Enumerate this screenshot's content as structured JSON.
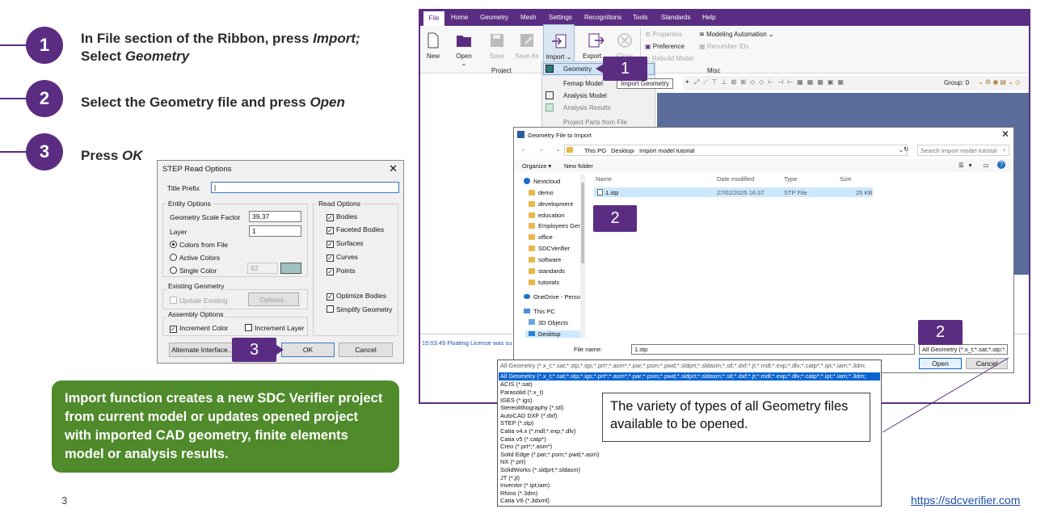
{
  "steps": [
    {
      "num": "1",
      "line1": "In File section of the Ribbon, press ",
      "em1": "Import;",
      "line2": "Select ",
      "em2": "Geometry"
    },
    {
      "num": "2",
      "text": "Select the Geometry file and press ",
      "em": "Open"
    },
    {
      "num": "3",
      "text": "Press ",
      "em": "OK"
    }
  ],
  "note": "Import function creates a new SDC Verifier project from current model or updates opened project with imported CAD geometry, finite elements model or analysis results.",
  "page_number": "3",
  "website": "https://sdcverifier.com",
  "step_dialog": {
    "title": "STEP Read Options",
    "title_prefix_label": "Title Prefix",
    "entity_options": "Entity Options",
    "scale_label": "Geometry Scale Factor",
    "scale_value": "39,37",
    "layer_label": "Layer",
    "layer_value": "1",
    "colors_from_file": "Colors from File",
    "active_colors": "Active Colors",
    "single_color": "Single Color",
    "single_color_value": "92",
    "existing_geometry": "Existing Geometry",
    "update_existing": "Update Existing",
    "options_btn": "Options..",
    "assembly_options": "Assembly Options",
    "increment_color": "Increment Color",
    "increment_layer": "Increment Layer",
    "read_options": "Read Options",
    "read_items": [
      "Bodies",
      "Faceted Bodies",
      "Surfaces",
      "Curves",
      "Points"
    ],
    "optimize_bodies": "Optimize Bodies",
    "simplify_geometry": "Simplify Geometry",
    "alt_btn": "Alternate Interface...",
    "ok_btn": "OK",
    "cancel_btn": "Cancel"
  },
  "app": {
    "menu": [
      "File",
      "Home",
      "Geometry",
      "Mesh",
      "Settings",
      "Recognitions",
      "Tools",
      "Standards",
      "Help"
    ],
    "ribbon": {
      "new": "New",
      "open": "Open",
      "save": "Save",
      "save_as": "Save As",
      "import": "Import",
      "export": "Export",
      "close": "Close",
      "properties": "Properties",
      "preference": "Preference",
      "rebuild_model": "Rebuild Model",
      "modeling_automation": "Modeling Automation",
      "renumber_ids": "Renumber IDs",
      "project_group": "Project",
      "misc_group": "Misc"
    },
    "group_label": "Group: 0",
    "log_text": "15:03:49 Floating License was su"
  },
  "import_menu": {
    "items": [
      "Geometry",
      "Femap Model",
      "Analysis Model",
      "Analysis Results",
      "Project Parts from File"
    ],
    "tooltip": "Import Geometry"
  },
  "file_dialog": {
    "title": "Geometry File to Import",
    "path": [
      "This PC",
      "Desktop",
      "Import model tutorial"
    ],
    "search_placeholder": "Search Import model tutorial",
    "organize": "Organize",
    "new_folder": "New folder",
    "nav": [
      "Nextcloud",
      "demo",
      "development",
      "education",
      "Employees Gene",
      "office",
      "SDCVerifier",
      "software",
      "standards",
      "tutorials",
      "OneDrive - Persor",
      "This PC",
      "3D Objects",
      "Desktop"
    ],
    "columns": [
      "Name",
      "Date modified",
      "Type",
      "Size"
    ],
    "file": {
      "name": "1.stp",
      "date": "27/02/2025 16:37",
      "type": "STP File",
      "size": "25 KB"
    },
    "file_name_label": "File name:",
    "file_name_value": "1.stp",
    "file_type_value": "All Geometry (*.x_t;*.sat;*.stp;*.",
    "open_btn": "Open",
    "cancel_btn": "Cancel"
  },
  "type_list": {
    "header": "All Geometry (*.x_t;*.sat;*.stp;*.igs;*.prt*;*.asm*;*.par;*.psm;*.pwd;*.sldprt;*.sldasm;*.stl;*.dxf;*.jt;*.mdl;*.exp;*.dlv;*.catp*;*.ipt;*.iam;*.3dm;",
    "items": [
      "All Geometry (*.x_t;*.sat;*.stp;*.igs;*.prt*;*.asm*;*.par;*.psm;*.pwd;*.sldprt;*.sldasm;*.stl;*.dxf;*.jt;*.mdl;*.exp;*.dlv;*.catp*;*.ipt;*.iam;*.3dm;",
      "ACIS (*.sat)",
      "Parasolid (*.x_t)",
      "IGES (*.igs)",
      "Stereolithography (*.stl)",
      "AutoCAD DXF (*.dxf)",
      "STEP (*.stp)",
      "Catia v4.x (*.mdl;*.exp;*.dlv)",
      "Catia v5 (*.catp*)",
      "Creo (*.prt*;*.asm*)",
      "Solid Edge (*.par;*.psm;*.pwd;*.asm)",
      "NX (*.prt)",
      "SolidWorks (*.sldprt;*.sldasm)",
      "JT (*.jt)",
      "Inventor (*.ipt;iam)",
      "Rhino (*.3dm)",
      "Catia V6 (*.3dxml)"
    ],
    "note": "The variety of types of all Geometry files available to be opened."
  },
  "callouts": [
    "1",
    "2",
    "2",
    "3"
  ],
  "colors": {
    "purple": "#5b2d82",
    "green": "#4f8a2b",
    "link": "#1f4fa8",
    "selection": "#0a64d0"
  }
}
